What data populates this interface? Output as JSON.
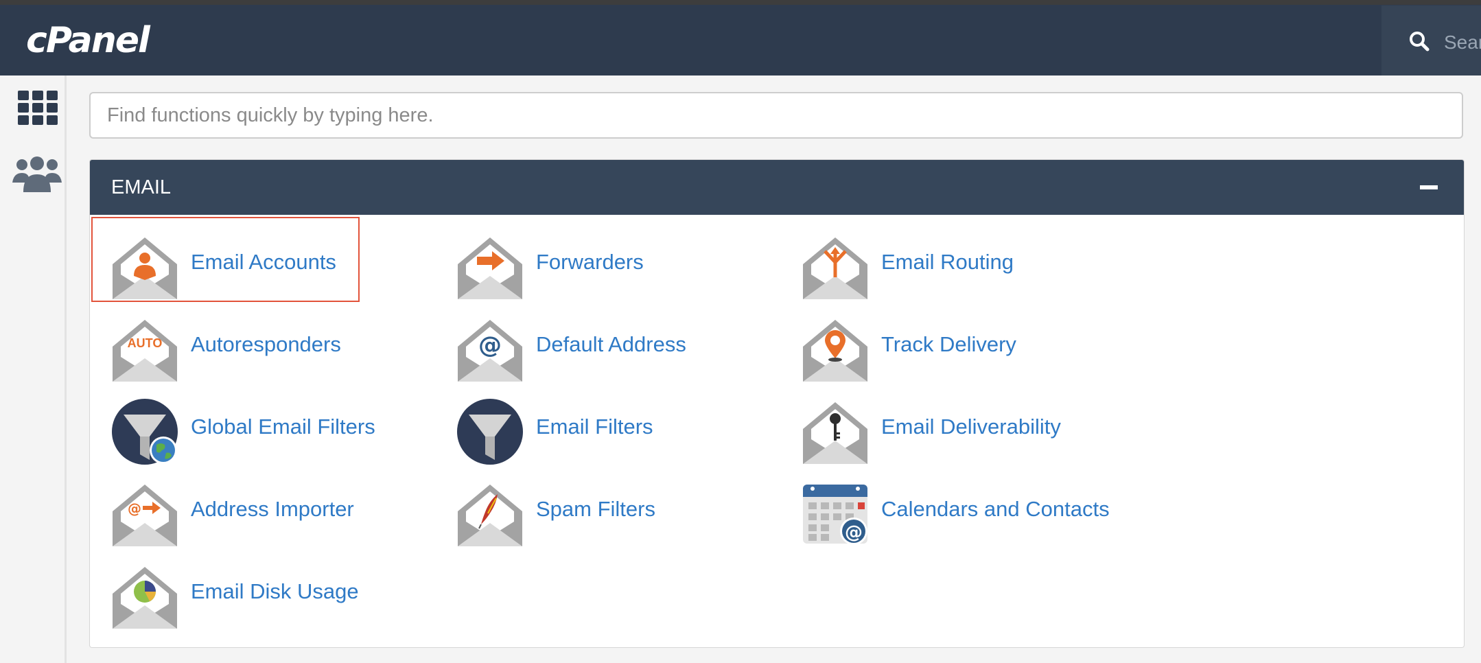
{
  "header": {
    "logo_text": "cPanel",
    "search_text": "Search"
  },
  "sidebar": {
    "items": [
      {
        "icon": "grid-icon"
      },
      {
        "icon": "users-icon"
      }
    ]
  },
  "quick_search": {
    "placeholder": "Find functions quickly by typing here."
  },
  "section": {
    "title": "EMAIL",
    "items": [
      {
        "label": "Email Accounts",
        "icon": "email-accounts-icon",
        "selected": true
      },
      {
        "label": "Forwarders",
        "icon": "forwarders-icon"
      },
      {
        "label": "Email Routing",
        "icon": "email-routing-icon"
      },
      {
        "label": "Autoresponders",
        "icon": "autoresponders-icon",
        "icon_text": "AUTO"
      },
      {
        "label": "Default Address",
        "icon": "default-address-icon",
        "icon_text": "@"
      },
      {
        "label": "Track Delivery",
        "icon": "track-delivery-icon"
      },
      {
        "label": "Global Email Filters",
        "icon": "global-email-filters-icon"
      },
      {
        "label": "Email Filters",
        "icon": "email-filters-icon"
      },
      {
        "label": "Email Deliverability",
        "icon": "email-deliverability-icon"
      },
      {
        "label": "Address Importer",
        "icon": "address-importer-icon",
        "icon_text": "@"
      },
      {
        "label": "Spam Filters",
        "icon": "spam-filters-icon"
      },
      {
        "label": "Calendars and Contacts",
        "icon": "calendars-contacts-icon",
        "icon_text": "@"
      },
      {
        "label": "Email Disk Usage",
        "icon": "email-disk-usage-icon"
      }
    ]
  },
  "colors": {
    "header_bg": "#2e3b4e",
    "panel_header_bg": "#36465a",
    "link": "#2f7ac6",
    "accent_orange": "#e86f2a",
    "selection_border": "#e2533b"
  }
}
